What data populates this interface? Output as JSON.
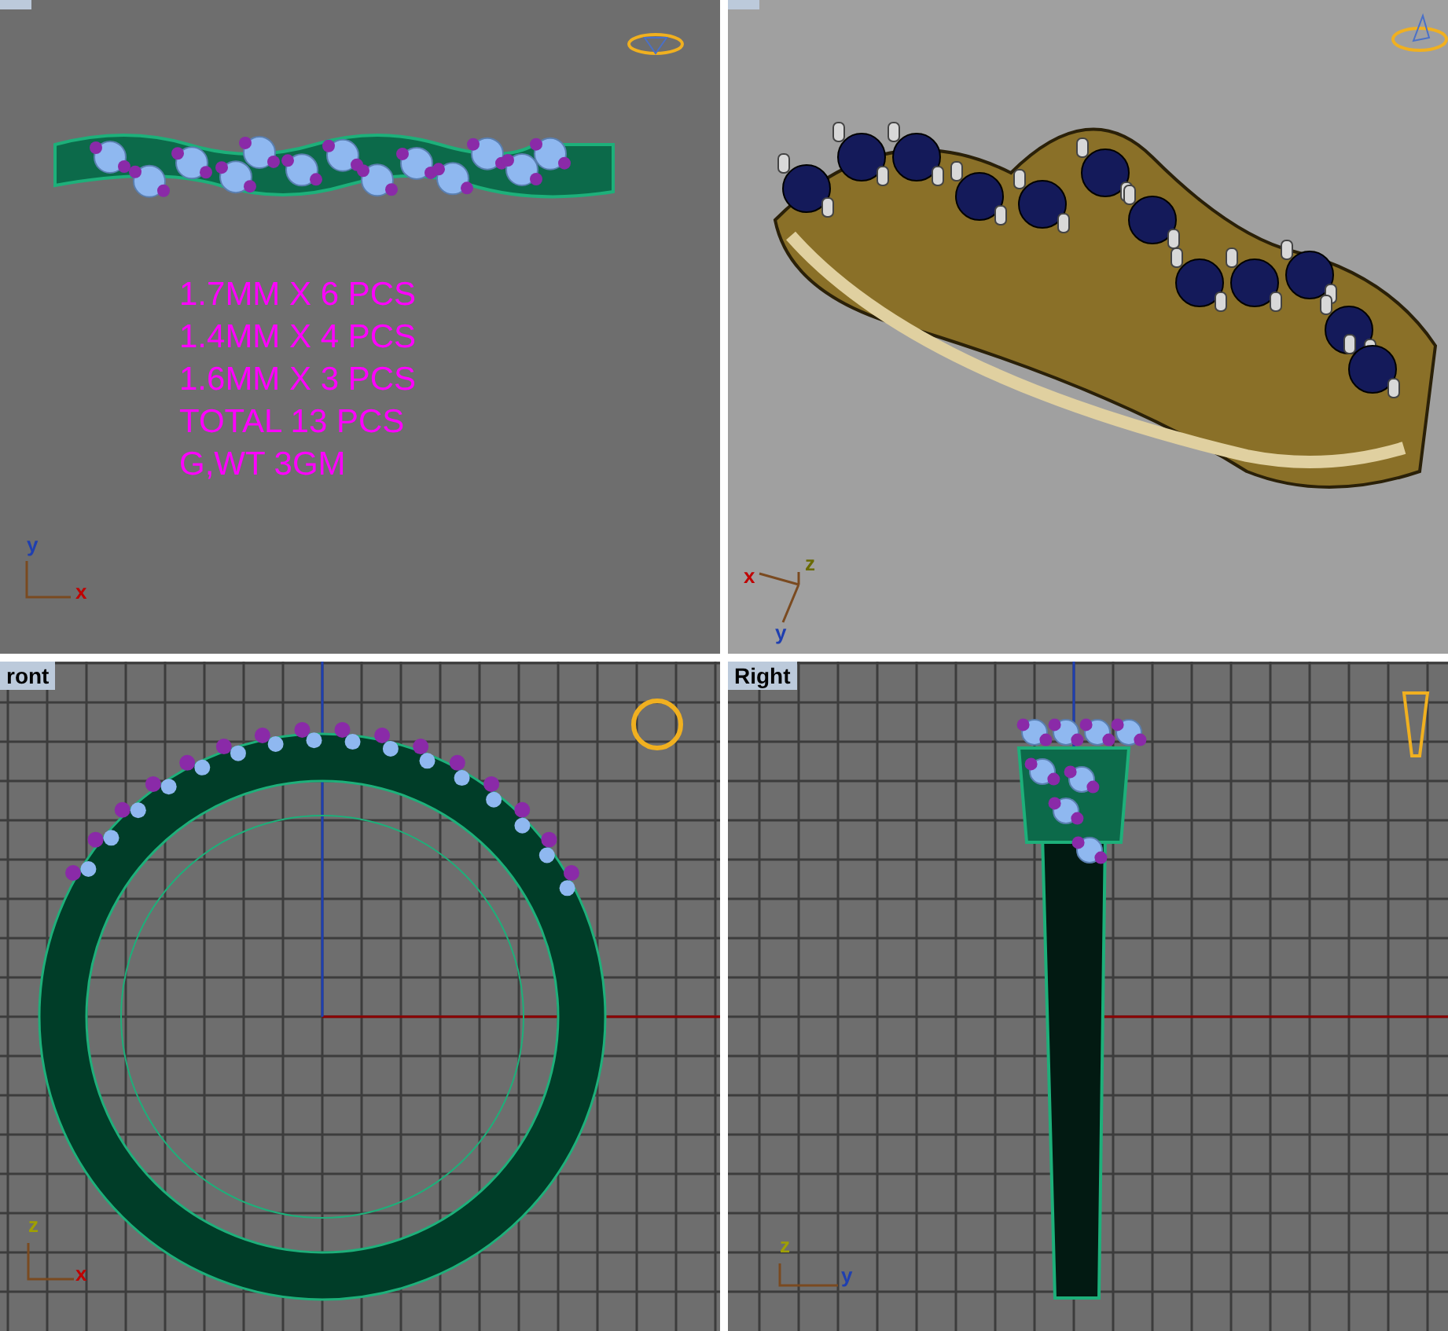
{
  "viewports": [
    {
      "kind": "top",
      "grid": false,
      "axes": [
        "y",
        "x"
      ],
      "notes": [
        "1.7MM X 6 PCS",
        "1.4MM X 4 PCS",
        "1.6MM X 3 PCS",
        "TOTAL 13 PCS",
        "G,WT 3GM"
      ]
    },
    {
      "kind": "perspective",
      "grid": false,
      "axes": [
        "x",
        "z",
        "y"
      ]
    },
    {
      "kind": "front",
      "label": "ront",
      "grid": true,
      "axes": [
        "z",
        "x"
      ]
    },
    {
      "kind": "right",
      "label": "Right",
      "grid": true,
      "axes": [
        "z",
        "y"
      ]
    }
  ]
}
